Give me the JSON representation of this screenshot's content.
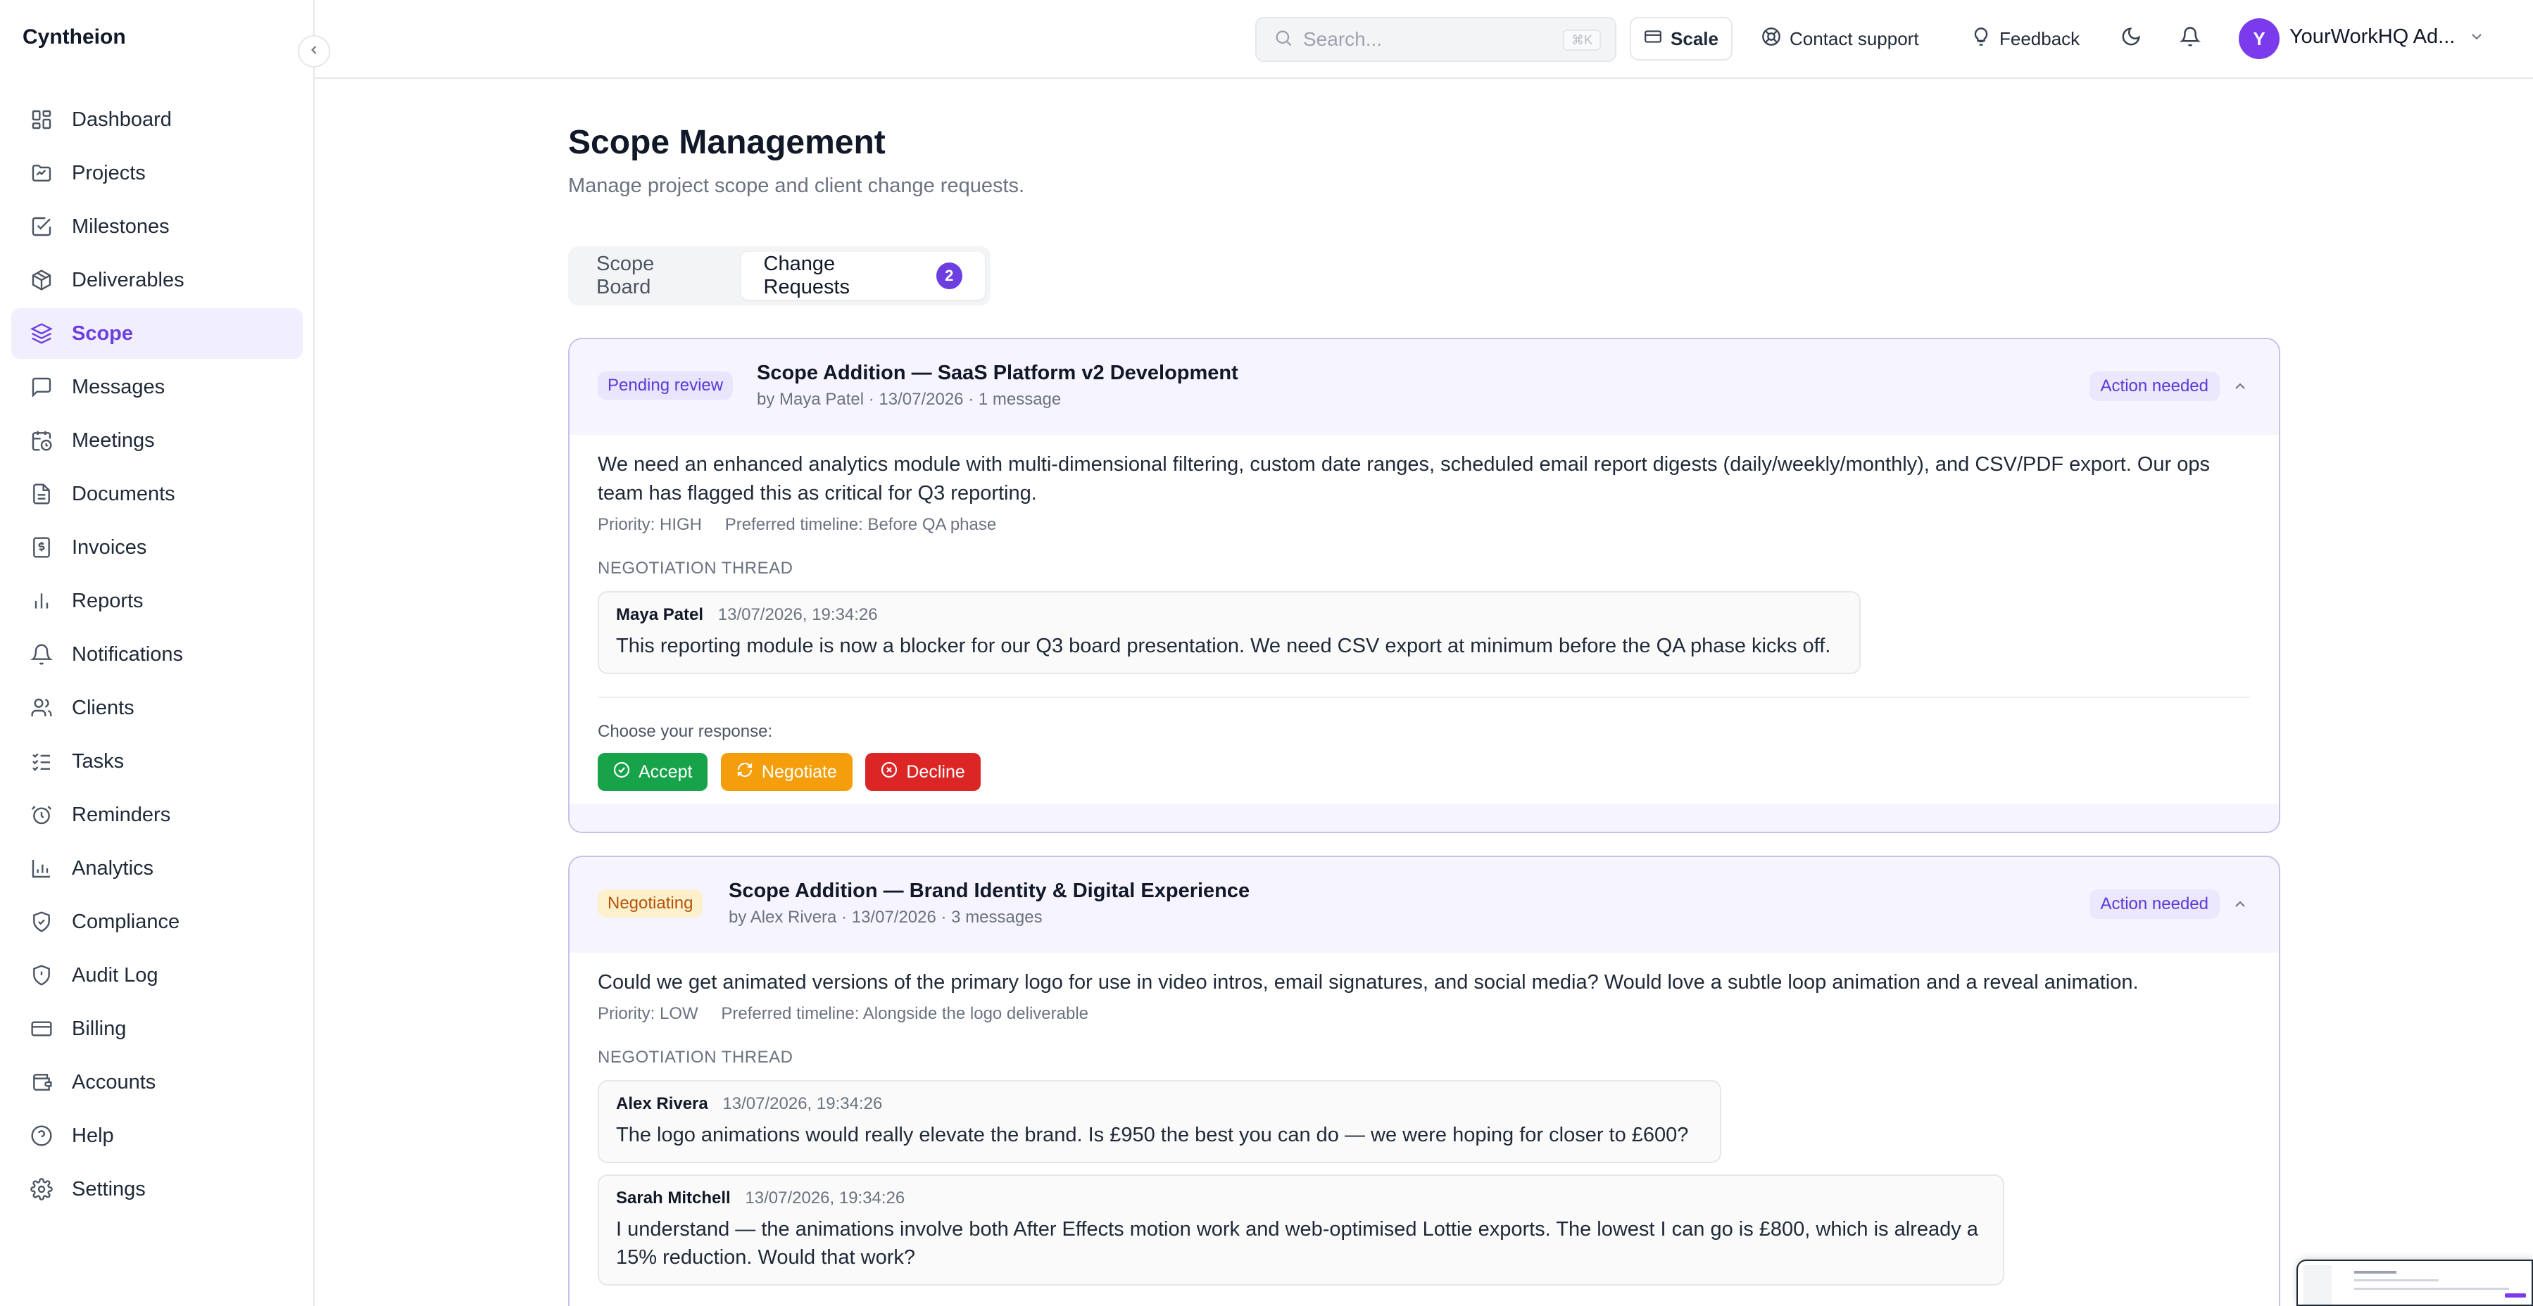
{
  "app": {
    "brand": "Cyntheion"
  },
  "sidebar": {
    "items": [
      {
        "label": "Dashboard",
        "icon": "dashboard-icon",
        "active": false
      },
      {
        "label": "Projects",
        "icon": "folder-icon",
        "active": false
      },
      {
        "label": "Milestones",
        "icon": "check-square-icon",
        "active": false
      },
      {
        "label": "Deliverables",
        "icon": "package-icon",
        "active": false
      },
      {
        "label": "Scope",
        "icon": "layers-icon",
        "active": true
      },
      {
        "label": "Messages",
        "icon": "message-icon",
        "active": false
      },
      {
        "label": "Meetings",
        "icon": "calendar-clock-icon",
        "active": false
      },
      {
        "label": "Documents",
        "icon": "document-icon",
        "active": false
      },
      {
        "label": "Invoices",
        "icon": "invoice-icon",
        "active": false
      },
      {
        "label": "Reports",
        "icon": "bar-chart-icon",
        "active": false
      },
      {
        "label": "Notifications",
        "icon": "bell-icon",
        "active": false
      },
      {
        "label": "Clients",
        "icon": "users-icon",
        "active": false
      },
      {
        "label": "Tasks",
        "icon": "list-checks-icon",
        "active": false
      },
      {
        "label": "Reminders",
        "icon": "alarm-clock-icon",
        "active": false
      },
      {
        "label": "Analytics",
        "icon": "analytics-icon",
        "active": false
      },
      {
        "label": "Compliance",
        "icon": "shield-check-icon",
        "active": false
      },
      {
        "label": "Audit Log",
        "icon": "shield-alert-icon",
        "active": false
      },
      {
        "label": "Billing",
        "icon": "credit-card-icon",
        "active": false
      },
      {
        "label": "Accounts",
        "icon": "wallet-icon",
        "active": false
      },
      {
        "label": "Help",
        "icon": "help-circle-icon",
        "active": false
      },
      {
        "label": "Settings",
        "icon": "gear-icon",
        "active": false
      }
    ]
  },
  "topbar": {
    "search_placeholder": "Search...",
    "search_shortcut": "⌘K",
    "scale_label": "Scale",
    "contact_label": "Contact support",
    "feedback_label": "Feedback",
    "avatar_initial": "Y",
    "user_name": "YourWorkHQ Ad..."
  },
  "page": {
    "title": "Scope Management",
    "subtitle": "Manage project scope and client change requests."
  },
  "tabs": [
    {
      "label": "Scope Board",
      "active": false
    },
    {
      "label": "Change Requests",
      "active": true,
      "count": "2"
    }
  ],
  "requests": [
    {
      "status": "Pending review",
      "title": "Scope Addition — SaaS Platform v2 Development",
      "meta": "by Maya Patel · 13/07/2026 · 1 message",
      "action": "Action needed",
      "description": "We need an enhanced analytics module with multi-dimensional filtering, custom date ranges, scheduled email report digests (daily/weekly/monthly), and CSV/PDF export. Our ops team has flagged this as critical for Q3 reporting.",
      "priority": "Priority: HIGH",
      "timeline": "Preferred timeline: Before QA phase",
      "thread_label": "NEGOTIATION THREAD",
      "messages": [
        {
          "author": "Maya Patel",
          "time": "13/07/2026, 19:34:26",
          "text": "This reporting module is now a blocker for our Q3 board presentation. We need CSV export at minimum before the QA phase kicks off."
        }
      ],
      "choose_label": "Choose your response:",
      "buttons": {
        "accept": "Accept",
        "negotiate": "Negotiate",
        "decline": "Decline"
      }
    },
    {
      "status": "Negotiating",
      "title": "Scope Addition — Brand Identity & Digital Experience",
      "meta": "by Alex Rivera · 13/07/2026 · 3 messages",
      "action": "Action needed",
      "description": "Could we get animated versions of the primary logo for use in video intros, email signatures, and social media? Would love a subtle loop animation and a reveal animation.",
      "priority": "Priority: LOW",
      "timeline": "Preferred timeline: Alongside the logo deliverable",
      "thread_label": "NEGOTIATION THREAD",
      "messages": [
        {
          "author": "Alex Rivera",
          "time": "13/07/2026, 19:34:26",
          "text": "The logo animations would really elevate the brand. Is £950 the best you can do — we were hoping for closer to £600?"
        },
        {
          "author": "Sarah Mitchell",
          "time": "13/07/2026, 19:34:26",
          "text": "I understand — the animations involve both After Effects motion work and web-optimised Lottie exports. The lowest I can go is £800, which is already a 15% reduction. Would that work?"
        }
      ]
    }
  ],
  "colors": {
    "accent": "#6d3fe0",
    "accept": "#16a34a",
    "negotiate": "#f59e0b",
    "decline": "#dc2626"
  }
}
